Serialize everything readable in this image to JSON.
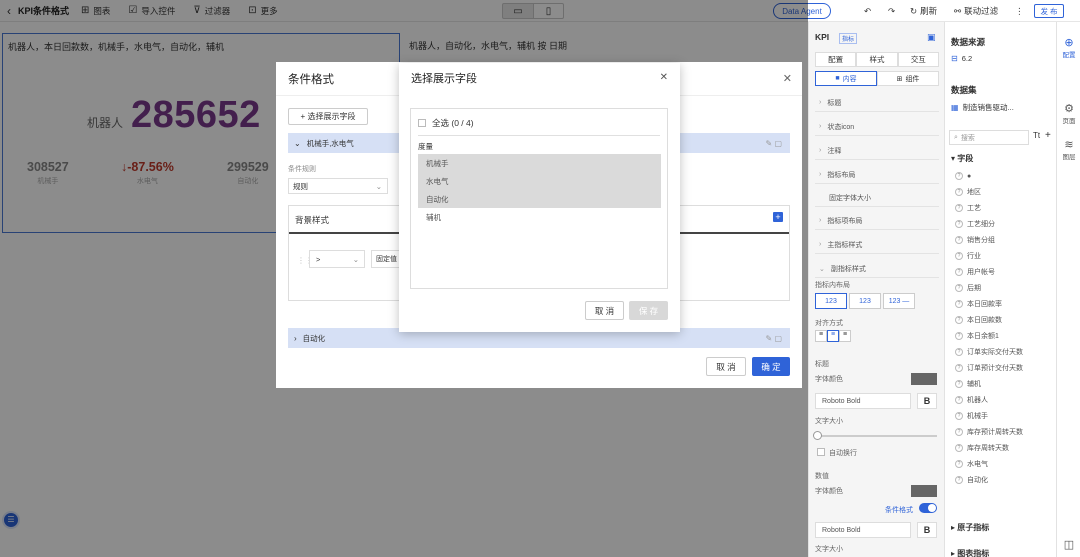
{
  "topbar": {
    "title": "KPI条件格式",
    "items": [
      {
        "icon": "chart-icon",
        "glyph": "⊞",
        "label": "图表"
      },
      {
        "icon": "import-icon",
        "glyph": "☑",
        "label": "导入控件"
      },
      {
        "icon": "filter-icon",
        "glyph": "⊽",
        "label": "过滤器"
      },
      {
        "icon": "more-icon",
        "glyph": "⊡",
        "label": "更多"
      }
    ],
    "agent": "Data Agent",
    "refresh": "刷新",
    "linked_filter": "联动过滤",
    "publish": "发 布"
  },
  "widget1": {
    "title": "机器人，本日回款数，机械手，水电气，自动化，辅机",
    "kpi_label": "机器人",
    "kpi_value": "285652",
    "subs": [
      {
        "value": "308527",
        "label": "机械手"
      },
      {
        "value": "-87.56%",
        "label": "水电气"
      },
      {
        "value": "299529",
        "label": "自动化"
      }
    ]
  },
  "widget2": {
    "title": "机器人，自动化，水电气，辅机 按 日期"
  },
  "cond_dialog": {
    "title": "条件格式",
    "add_field": "+ 选择展示字段",
    "group1": "机械手,水电气",
    "rule_label": "条件规则",
    "rule_value": "规则",
    "bg_style": "背景样式",
    "operator": ">",
    "fixed": "固定值",
    "group2": "自动化",
    "cancel": "取 消",
    "ok": "确 定"
  },
  "field_dialog": {
    "title": "选择展示字段",
    "select_all": "全选 (0 / 4)",
    "category": "度量",
    "options": [
      {
        "label": "机械手",
        "highlight": true
      },
      {
        "label": "水电气",
        "highlight": true
      },
      {
        "label": "自动化",
        "highlight": true
      },
      {
        "label": "辅机",
        "highlight": false
      }
    ],
    "cancel": "取 消",
    "save": "保 存"
  },
  "config": {
    "title": "KPI",
    "badge": "指标",
    "tabs": [
      "配置",
      "样式",
      "交互"
    ],
    "subtabs": [
      "内容",
      "组件"
    ],
    "sections": [
      "标题",
      "状态icon",
      "注释",
      "指标布局",
      "固定字体大小",
      "指标项布局",
      "主指标样式",
      "副指标样式"
    ],
    "layout_label": "指标内布局",
    "layout_opts": [
      "123",
      "123",
      "123 —",
      "— 123"
    ],
    "align_label": "对齐方式",
    "name_label": "标题",
    "font_color_1": "字体颜色",
    "font_1": "Roboto Bold",
    "bold": "B",
    "text_size": "文字大小",
    "auto_wrap": "自动换行",
    "value_label": "数值",
    "font_color_2": "字体颜色",
    "cond_format": "条件格式",
    "font_2": "Roboto Bold",
    "text_size_2": "文字大小"
  },
  "data": {
    "source_title": "数据来源",
    "source_value": "6.2",
    "dataset_title": "数据集",
    "dataset_value": "制造销售驱动...",
    "search_placeholder": "搜索",
    "fields_title": "字段",
    "fields": [
      "●",
      "地区",
      "工艺",
      "工艺细分",
      "销售分组",
      "行业",
      "用户帐号",
      "后期",
      "本日回款率",
      "本日回款数",
      "本日余额1",
      "订单实际交付天数",
      "订单预计交付天数",
      "辅机",
      "机器人",
      "机械手",
      "库存预计周转天数",
      "库存周转天数",
      "水电气",
      "自动化"
    ],
    "sub_metric": "原子指标",
    "chart_data": "图表指标"
  },
  "rail": [
    {
      "icon": "config-icon",
      "glyph": "⊕",
      "label": "配置",
      "on": true
    },
    {
      "icon": "page-icon",
      "glyph": "⚙",
      "label": "页面",
      "on": false
    },
    {
      "icon": "layer-icon",
      "glyph": "≋",
      "label": "图层",
      "on": false
    }
  ]
}
